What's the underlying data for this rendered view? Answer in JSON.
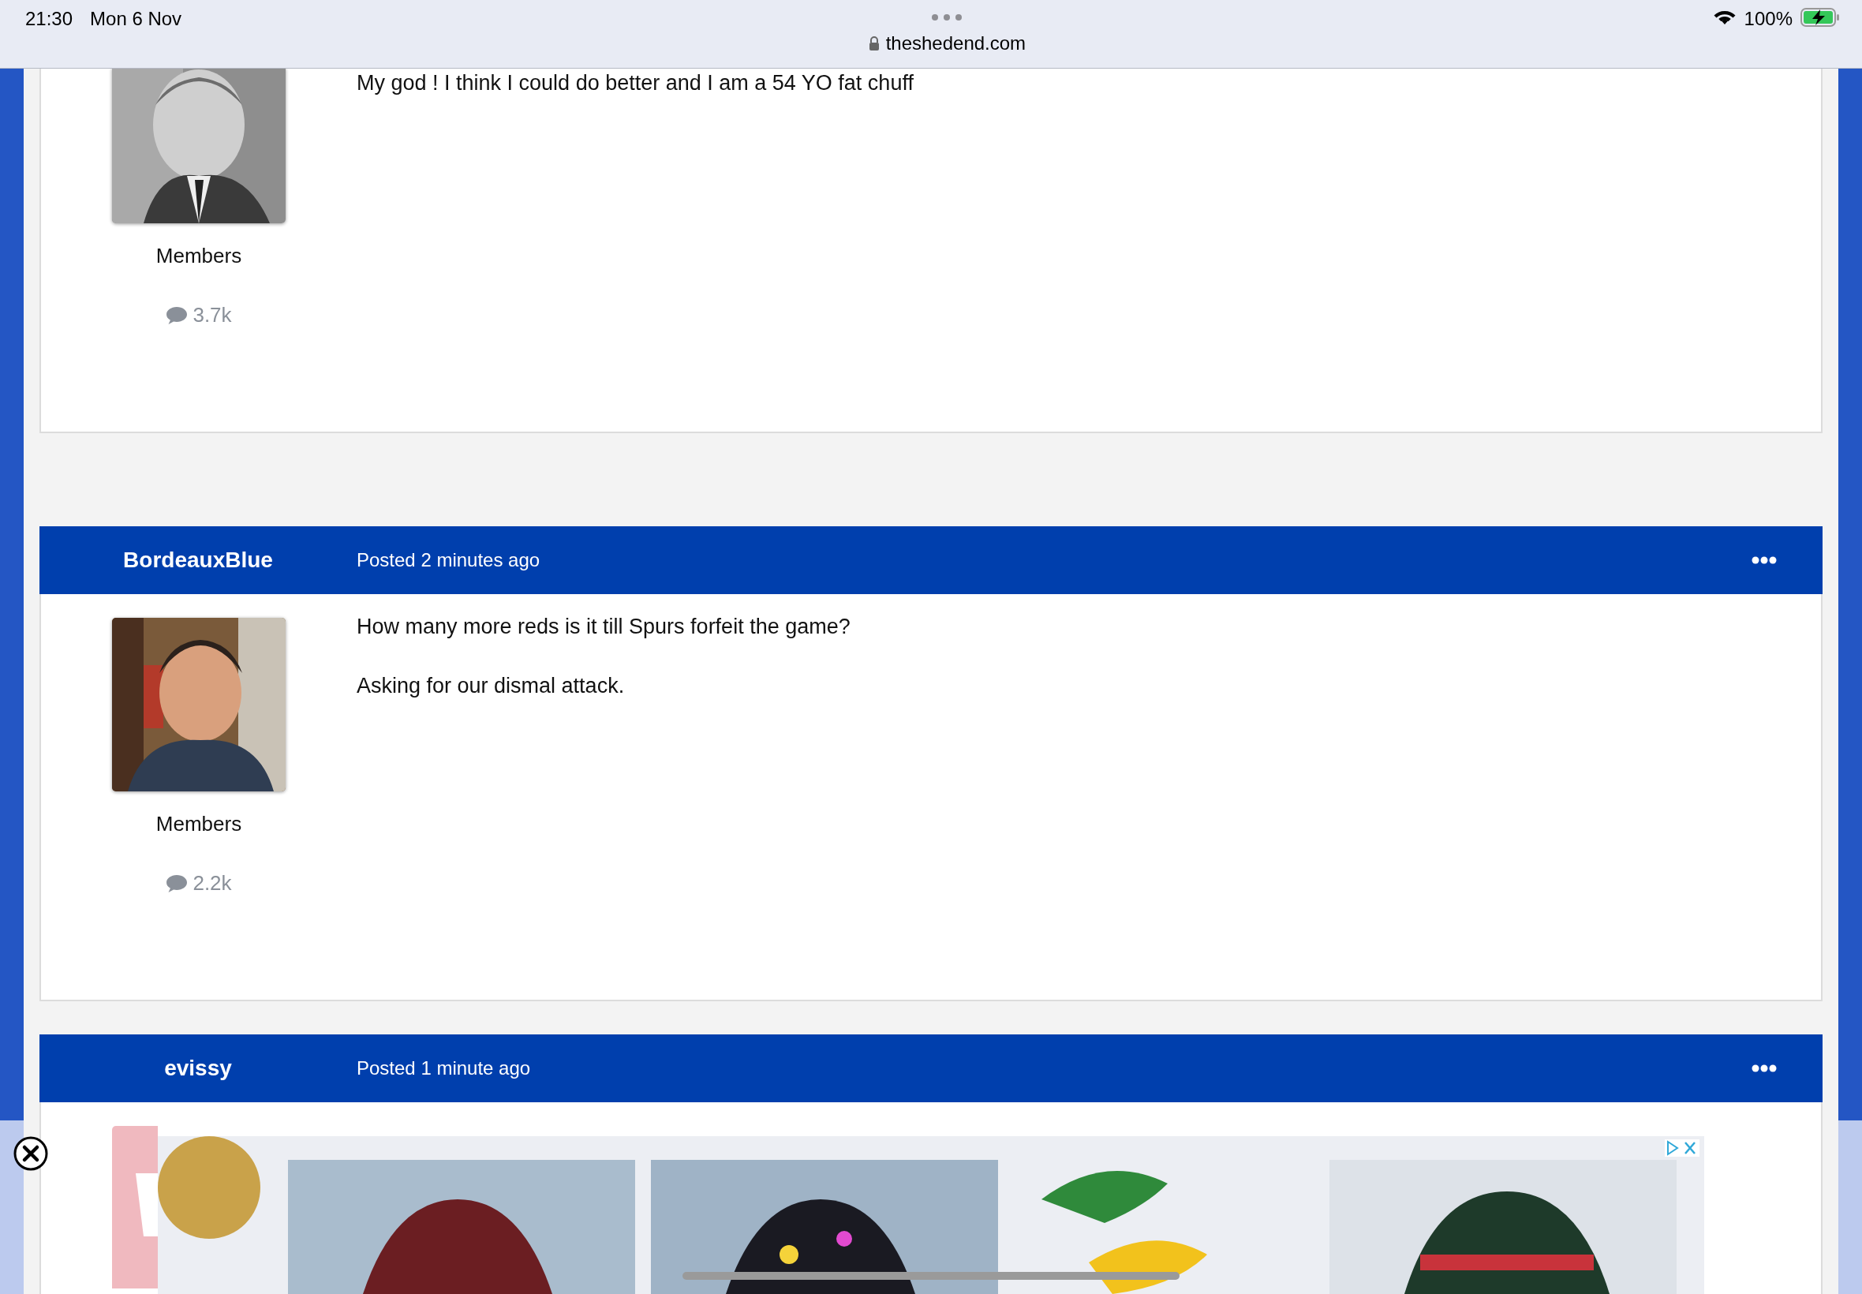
{
  "status_bar": {
    "time": "21:30",
    "date": "Mon 6 Nov",
    "battery": "100%",
    "charging": true
  },
  "address_bar": {
    "url": "theshedend.com"
  },
  "posts": [
    {
      "paragraphs": [
        "My god !   I think I could do better and I am a 54 YO fat chuff"
      ],
      "group": "Members",
      "posts_count": "3.7k"
    },
    {
      "author": "BordeauxBlue",
      "posted": "Posted 2 minutes ago",
      "paragraphs": [
        "How many more reds is it till Spurs forfeit the game?",
        "Asking for our dismal attack."
      ],
      "group": "Members",
      "posts_count": "2.2k"
    },
    {
      "author": "evissy",
      "posted": "Posted 1 minute ago"
    }
  ]
}
